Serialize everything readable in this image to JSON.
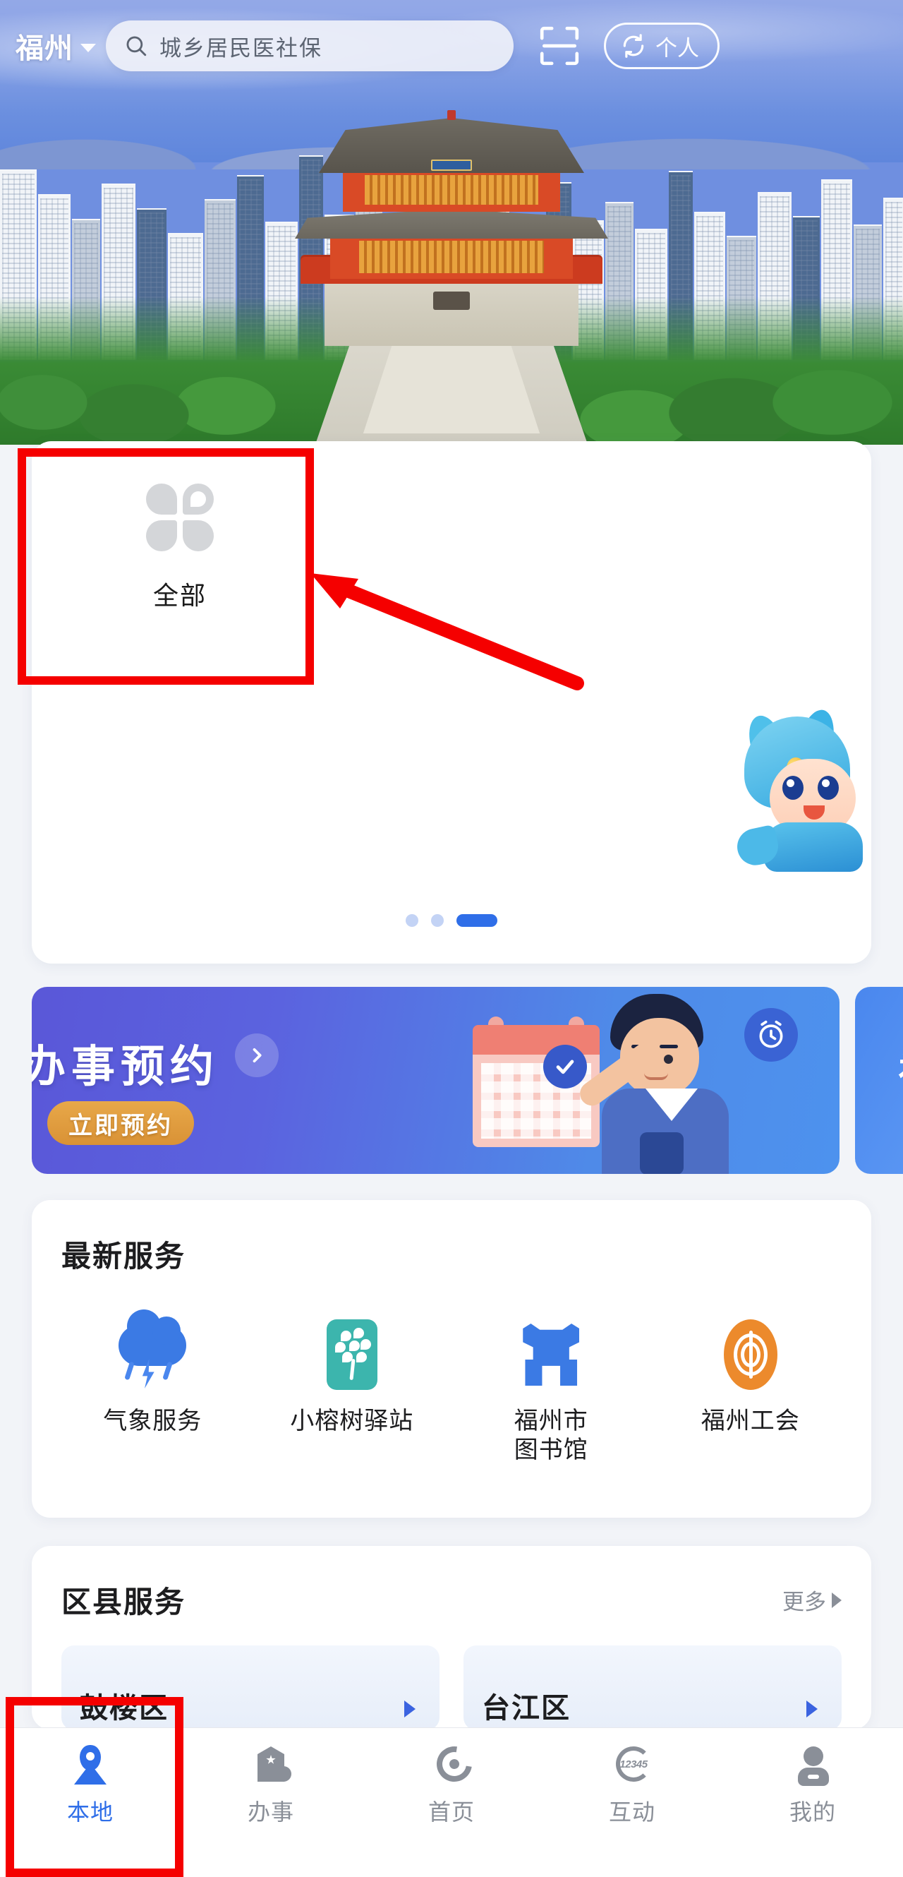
{
  "header": {
    "city": "福州",
    "city_dropdown_icon": "chevron-down-icon",
    "search": {
      "icon": "search-icon",
      "value": "城乡居民医社保",
      "placeholder": "城乡居民医社保"
    },
    "scan_icon": "scan-qr-icon",
    "personal": {
      "icon": "switch-account-icon",
      "label": "个人"
    }
  },
  "hero": {
    "alt": "福州城市风光 镇海楼",
    "description": "city-skyline-with-traditional-building"
  },
  "quick_grid": {
    "items": [
      {
        "icon": "clover-grid-icon",
        "label": "全部"
      }
    ],
    "mascot": "blue-mascot-character",
    "pagination": {
      "total": 3,
      "active": 3
    }
  },
  "banner": {
    "title": "办事预约",
    "arrow_icon": "chevron-right-icon",
    "cta_label": "立即预约",
    "art": {
      "calendar": "calendar-with-check-icon",
      "check_icon": "check-icon",
      "person": "man-pointing-illustration",
      "alarm_icon": "alarm-clock-icon"
    },
    "next_banner_peek": "福"
  },
  "sections": [
    {
      "key": "latest_services",
      "title": "最新服务",
      "more_label": "",
      "items": [
        {
          "icon": "weather-cloud-lightning-icon",
          "label": "气象服务"
        },
        {
          "icon": "small-banyan-tree-station-icon",
          "label": "小榕树驿站"
        },
        {
          "icon": "fuzhou-library-gate-icon",
          "label": "福州市\n图书馆"
        },
        {
          "icon": "fuzhou-union-icon",
          "label": "福州工会"
        }
      ]
    },
    {
      "key": "district_services",
      "title": "区县服务",
      "more_label": "更多",
      "more_icon": "chevron-right-icon",
      "items": [
        {
          "label": "鼓楼区",
          "chevron": "chevron-right-icon"
        },
        {
          "label": "台江区",
          "chevron": "chevron-right-icon"
        }
      ]
    }
  ],
  "tabbar": {
    "items": [
      {
        "icon": "location-pin-icon",
        "label": "本地",
        "active": true
      },
      {
        "icon": "government-building-icon",
        "label": "办事",
        "active": false
      },
      {
        "icon": "home-swirl-icon",
        "label": "首页",
        "active": false
      },
      {
        "icon": "hotline-12345-icon",
        "label": "互动",
        "active": false,
        "badge_text": "12345"
      },
      {
        "icon": "user-person-icon",
        "label": "我的",
        "active": false
      }
    ]
  },
  "annotations": {
    "color": "#f50000",
    "boxes": [
      {
        "name": "highlight-all-button",
        "target": "全部"
      },
      {
        "name": "highlight-local-tab",
        "target": "本地"
      }
    ],
    "arrow": {
      "name": "pointer-arrow",
      "points_to": "全部"
    }
  },
  "theme": {
    "accent": "#2f6ee8",
    "banner_start": "#5a57d8",
    "banner_end": "#4d92ee",
    "cta": "#e8a849",
    "muted_text": "#8a8f98",
    "annotation_red": "#f50000"
  }
}
